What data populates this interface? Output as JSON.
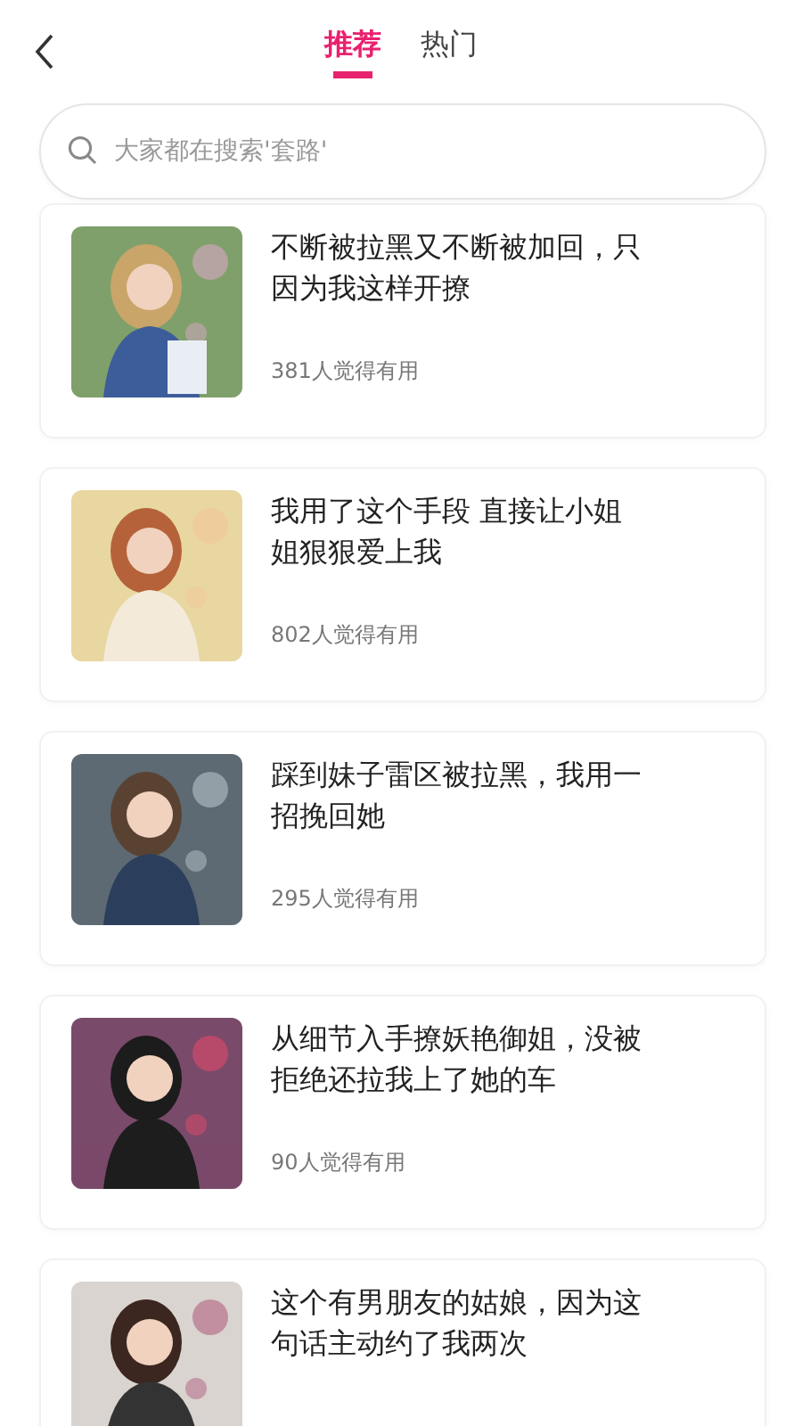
{
  "header": {
    "tabs": [
      {
        "label": "推荐",
        "selected": true
      },
      {
        "label": "热门",
        "selected": false
      }
    ]
  },
  "search": {
    "placeholder": "大家都在搜索'套路'"
  },
  "articles": [
    {
      "title": "不断被拉黑又不断被加回，只因为我这样开撩",
      "helpful": "381人觉得有用"
    },
    {
      "title": "我用了这个手段 直接让小姐姐狠狠爱上我",
      "helpful": "802人觉得有用"
    },
    {
      "title": "踩到妹子雷区被拉黑，我用一招挽回她",
      "helpful": "295人觉得有用"
    },
    {
      "title": "从细节入手撩妖艳御姐，没被拒绝还拉我上了她的车",
      "helpful": "90人觉得有用"
    },
    {
      "title": "这个有男朋友的姑娘，因为这句话主动约了我两次"
    }
  ]
}
